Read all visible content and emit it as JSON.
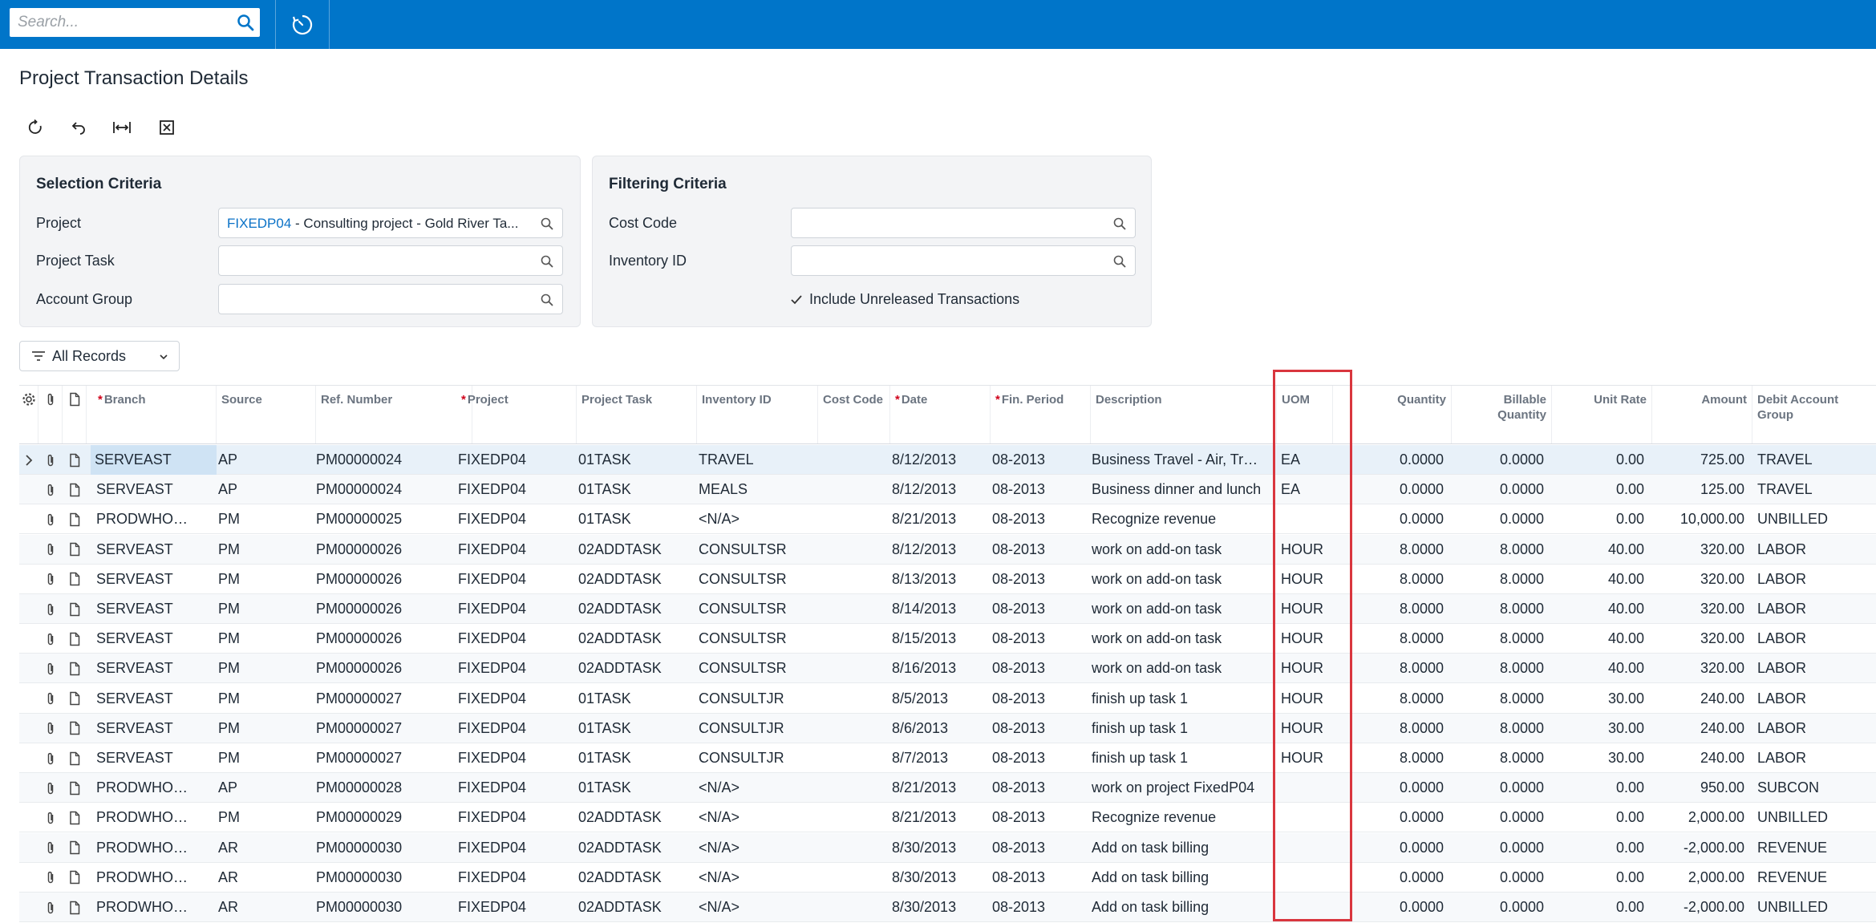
{
  "search": {
    "placeholder": "Search..."
  },
  "page": {
    "title": "Project Transaction Details"
  },
  "selection": {
    "title": "Selection Criteria",
    "project_label": "Project",
    "project_id": "FIXEDP04",
    "project_desc": " - Consulting project - Gold River Ta...",
    "project_task_label": "Project Task",
    "project_task_value": "",
    "account_group_label": "Account Group",
    "account_group_value": ""
  },
  "filtering": {
    "title": "Filtering Criteria",
    "cost_code_label": "Cost Code",
    "cost_code_value": "",
    "inventory_label": "Inventory ID",
    "inventory_value": "",
    "include_unreleased_label": "Include Unreleased Transactions",
    "include_unreleased_checked": true
  },
  "filter_button": {
    "label": "All Records"
  },
  "grid": {
    "headers": {
      "branch": "Branch",
      "source": "Source",
      "ref": "Ref. Number",
      "project": "Project",
      "task": "Project Task",
      "inventory": "Inventory ID",
      "cost_code": "Cost Code",
      "date": "Date",
      "fin_period": "Fin. Period",
      "description": "Description",
      "uom": "UOM",
      "quantity": "Quantity",
      "billable_qty": "Billable Quantity",
      "unit_rate": "Unit Rate",
      "amount": "Amount",
      "debit_group": "Debit Account Group"
    },
    "rows": [
      {
        "branch": "SERVEAST",
        "source": "AP",
        "ref": "PM00000024",
        "project": "FIXEDP04",
        "task": "01TASK",
        "inventory": "TRAVEL",
        "cost_code": "",
        "date": "8/12/2013",
        "period": "08-2013",
        "description": "Business Travel - Air, Train, Car",
        "uom": "EA",
        "qty": "0.0000",
        "bqty": "0.0000",
        "rate": "0.00",
        "amount": "725.00",
        "group": "TRAVEL"
      },
      {
        "branch": "SERVEAST",
        "source": "AP",
        "ref": "PM00000024",
        "project": "FIXEDP04",
        "task": "01TASK",
        "inventory": "MEALS",
        "cost_code": "",
        "date": "8/12/2013",
        "period": "08-2013",
        "description": "Business dinner and lunch",
        "uom": "EA",
        "qty": "0.0000",
        "bqty": "0.0000",
        "rate": "0.00",
        "amount": "125.00",
        "group": "TRAVEL"
      },
      {
        "branch": "PRODWHOLE",
        "source": "PM",
        "ref": "PM00000025",
        "project": "FIXEDP04",
        "task": "01TASK",
        "inventory": "<N/A>",
        "cost_code": "",
        "date": "8/21/2013",
        "period": "08-2013",
        "description": "Recognize revenue",
        "uom": "",
        "qty": "0.0000",
        "bqty": "0.0000",
        "rate": "0.00",
        "amount": "10,000.00",
        "group": "UNBILLED"
      },
      {
        "branch": "SERVEAST",
        "source": "PM",
        "ref": "PM00000026",
        "project": "FIXEDP04",
        "task": "02ADDTASK",
        "inventory": "CONSULTSR",
        "cost_code": "",
        "date": "8/12/2013",
        "period": "08-2013",
        "description": "work on add-on task",
        "uom": "HOUR",
        "qty": "8.0000",
        "bqty": "8.0000",
        "rate": "40.00",
        "amount": "320.00",
        "group": "LABOR"
      },
      {
        "branch": "SERVEAST",
        "source": "PM",
        "ref": "PM00000026",
        "project": "FIXEDP04",
        "task": "02ADDTASK",
        "inventory": "CONSULTSR",
        "cost_code": "",
        "date": "8/13/2013",
        "period": "08-2013",
        "description": "work on add-on task",
        "uom": "HOUR",
        "qty": "8.0000",
        "bqty": "8.0000",
        "rate": "40.00",
        "amount": "320.00",
        "group": "LABOR"
      },
      {
        "branch": "SERVEAST",
        "source": "PM",
        "ref": "PM00000026",
        "project": "FIXEDP04",
        "task": "02ADDTASK",
        "inventory": "CONSULTSR",
        "cost_code": "",
        "date": "8/14/2013",
        "period": "08-2013",
        "description": "work on add-on task",
        "uom": "HOUR",
        "qty": "8.0000",
        "bqty": "8.0000",
        "rate": "40.00",
        "amount": "320.00",
        "group": "LABOR"
      },
      {
        "branch": "SERVEAST",
        "source": "PM",
        "ref": "PM00000026",
        "project": "FIXEDP04",
        "task": "02ADDTASK",
        "inventory": "CONSULTSR",
        "cost_code": "",
        "date": "8/15/2013",
        "period": "08-2013",
        "description": "work on add-on task",
        "uom": "HOUR",
        "qty": "8.0000",
        "bqty": "8.0000",
        "rate": "40.00",
        "amount": "320.00",
        "group": "LABOR"
      },
      {
        "branch": "SERVEAST",
        "source": "PM",
        "ref": "PM00000026",
        "project": "FIXEDP04",
        "task": "02ADDTASK",
        "inventory": "CONSULTSR",
        "cost_code": "",
        "date": "8/16/2013",
        "period": "08-2013",
        "description": "work on add-on task",
        "uom": "HOUR",
        "qty": "8.0000",
        "bqty": "8.0000",
        "rate": "40.00",
        "amount": "320.00",
        "group": "LABOR"
      },
      {
        "branch": "SERVEAST",
        "source": "PM",
        "ref": "PM00000027",
        "project": "FIXEDP04",
        "task": "01TASK",
        "inventory": "CONSULTJR",
        "cost_code": "",
        "date": "8/5/2013",
        "period": "08-2013",
        "description": "finish up task 1",
        "uom": "HOUR",
        "qty": "8.0000",
        "bqty": "8.0000",
        "rate": "30.00",
        "amount": "240.00",
        "group": "LABOR"
      },
      {
        "branch": "SERVEAST",
        "source": "PM",
        "ref": "PM00000027",
        "project": "FIXEDP04",
        "task": "01TASK",
        "inventory": "CONSULTJR",
        "cost_code": "",
        "date": "8/6/2013",
        "period": "08-2013",
        "description": "finish up task 1",
        "uom": "HOUR",
        "qty": "8.0000",
        "bqty": "8.0000",
        "rate": "30.00",
        "amount": "240.00",
        "group": "LABOR"
      },
      {
        "branch": "SERVEAST",
        "source": "PM",
        "ref": "PM00000027",
        "project": "FIXEDP04",
        "task": "01TASK",
        "inventory": "CONSULTJR",
        "cost_code": "",
        "date": "8/7/2013",
        "period": "08-2013",
        "description": "finish up task 1",
        "uom": "HOUR",
        "qty": "8.0000",
        "bqty": "8.0000",
        "rate": "30.00",
        "amount": "240.00",
        "group": "LABOR"
      },
      {
        "branch": "PRODWHOLE",
        "source": "AP",
        "ref": "PM00000028",
        "project": "FIXEDP04",
        "task": "01TASK",
        "inventory": "<N/A>",
        "cost_code": "",
        "date": "8/21/2013",
        "period": "08-2013",
        "description": "work on project FixedP04",
        "uom": "",
        "qty": "0.0000",
        "bqty": "0.0000",
        "rate": "0.00",
        "amount": "950.00",
        "group": "SUBCON"
      },
      {
        "branch": "PRODWHOLE",
        "source": "PM",
        "ref": "PM00000029",
        "project": "FIXEDP04",
        "task": "02ADDTASK",
        "inventory": "<N/A>",
        "cost_code": "",
        "date": "8/21/2013",
        "period": "08-2013",
        "description": "Recognize revenue",
        "uom": "",
        "qty": "0.0000",
        "bqty": "0.0000",
        "rate": "0.00",
        "amount": "2,000.00",
        "group": "UNBILLED"
      },
      {
        "branch": "PRODWHOLE",
        "source": "AR",
        "ref": "PM00000030",
        "project": "FIXEDP04",
        "task": "02ADDTASK",
        "inventory": "<N/A>",
        "cost_code": "",
        "date": "8/30/2013",
        "period": "08-2013",
        "description": "Add on task billing",
        "uom": "",
        "qty": "0.0000",
        "bqty": "0.0000",
        "rate": "0.00",
        "amount": "-2,000.00",
        "group": "REVENUE"
      },
      {
        "branch": "PRODWHOLE",
        "source": "AR",
        "ref": "PM00000030",
        "project": "FIXEDP04",
        "task": "02ADDTASK",
        "inventory": "<N/A>",
        "cost_code": "",
        "date": "8/30/2013",
        "period": "08-2013",
        "description": "Add on task billing",
        "uom": "",
        "qty": "0.0000",
        "bqty": "0.0000",
        "rate": "0.00",
        "amount": "2,000.00",
        "group": "REVENUE"
      },
      {
        "branch": "PRODWHOLE",
        "source": "AR",
        "ref": "PM00000030",
        "project": "FIXEDP04",
        "task": "02ADDTASK",
        "inventory": "<N/A>",
        "cost_code": "",
        "date": "8/30/2013",
        "period": "08-2013",
        "description": "Add on task billing",
        "uom": "",
        "qty": "0.0000",
        "bqty": "0.0000",
        "rate": "0.00",
        "amount": "-2,000.00",
        "group": "UNBILLED"
      }
    ]
  },
  "colors": {
    "accent": "#0075c9",
    "link": "#0b72c7",
    "highlight": "#d9363e"
  }
}
